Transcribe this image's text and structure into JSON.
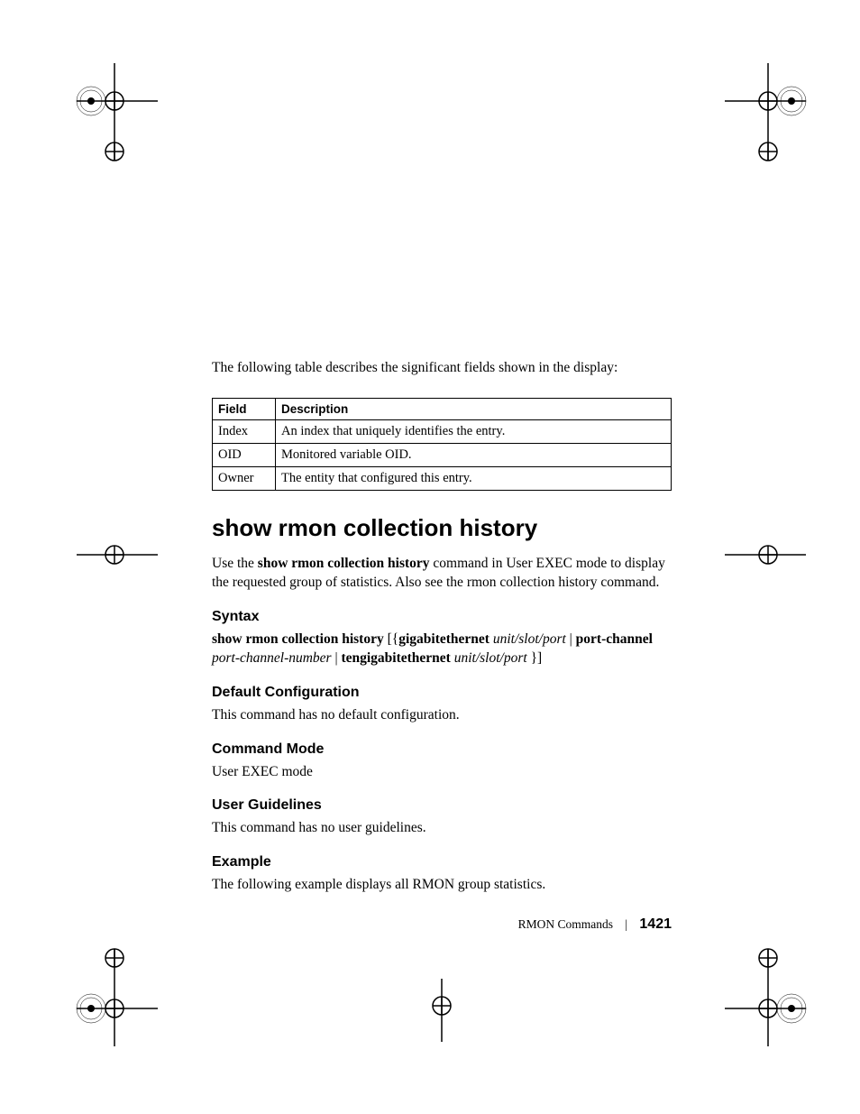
{
  "intro": "The following table describes the significant fields shown in the display:",
  "table": {
    "headers": {
      "field": "Field",
      "desc": "Description"
    },
    "rows": [
      {
        "field": "Index",
        "desc": "An index that uniquely identifies the entry."
      },
      {
        "field": "OID",
        "desc": "Monitored variable OID."
      },
      {
        "field": "Owner",
        "desc": "The entity that configured this entry."
      }
    ]
  },
  "heading": "show rmon collection history",
  "para1_parts": {
    "a": "Use the ",
    "b": "show rmon collection history",
    "c": " command in User EXEC mode to display the requested group of statistics. Also see the rmon collection history command."
  },
  "syntax_h": "Syntax",
  "syntax_parts": {
    "a": "show rmon collection history",
    "b": " [{",
    "c": "gigabitethernet",
    "d": " ",
    "e": "unit/slot/port",
    "f": " | ",
    "g": "port-channel",
    "h": " ",
    "i": "port-channel-number",
    "j": " | ",
    "k": "tengigabitethernet",
    "l": " ",
    "m": "unit/slot/port",
    "n": " }]"
  },
  "defcfg_h": "Default Configuration",
  "defcfg_p": "This command has no default configuration.",
  "cmdmode_h": "Command Mode",
  "cmdmode_p": "User EXEC mode",
  "ug_h": "User Guidelines",
  "ug_p": "This command has no user guidelines.",
  "ex_h": "Example",
  "ex_p": "The following example displays all RMON group statistics.",
  "footer": {
    "section": "RMON Commands",
    "page": "1421"
  }
}
